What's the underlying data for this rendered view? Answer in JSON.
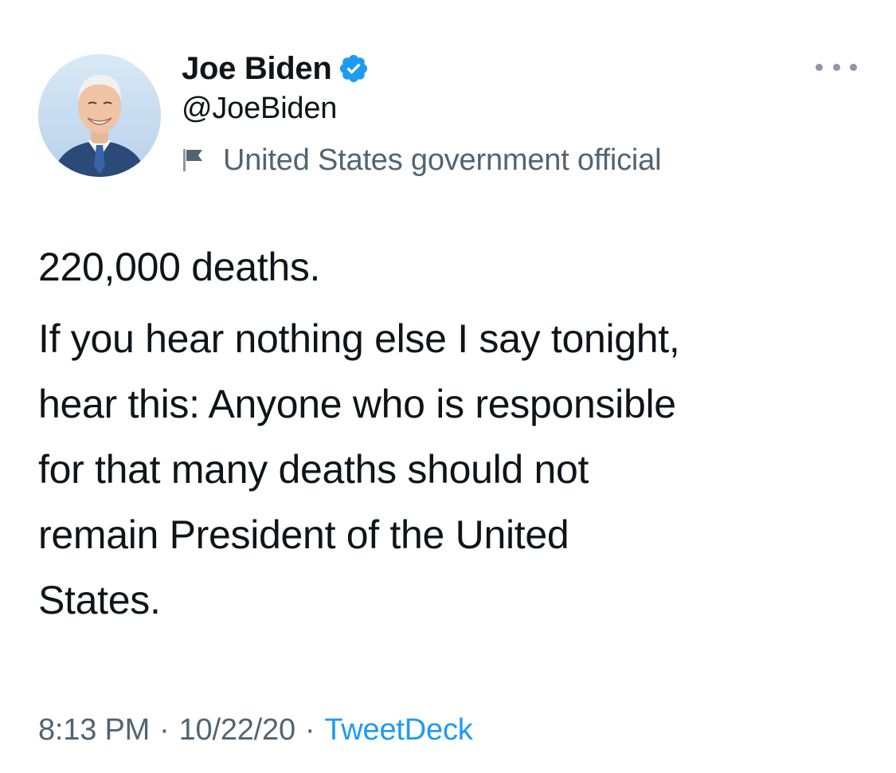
{
  "author": {
    "display_name": "Joe Biden",
    "handle": "@JoeBiden",
    "verified": true,
    "avatar_icon": "profile-photo",
    "label": "United States government official",
    "label_icon": "flag-icon"
  },
  "menu": {
    "more_icon": "more-horizontal-icon"
  },
  "tweet": {
    "paragraph_1": "220,000 deaths.",
    "paragraph_2_lines": [
      "If you hear nothing else I say tonight,",
      "hear this: Anyone who is responsible",
      "for that many deaths should not",
      "remain President of the United",
      "States."
    ]
  },
  "meta": {
    "time": "8:13 PM",
    "separator": "·",
    "date": "10/22/20",
    "source": "TweetDeck"
  },
  "colors": {
    "verified_badge": "#1d9bf0",
    "secondary_text": "#536471",
    "link": "#1d9bf0",
    "primary_text": "#0f1419"
  }
}
